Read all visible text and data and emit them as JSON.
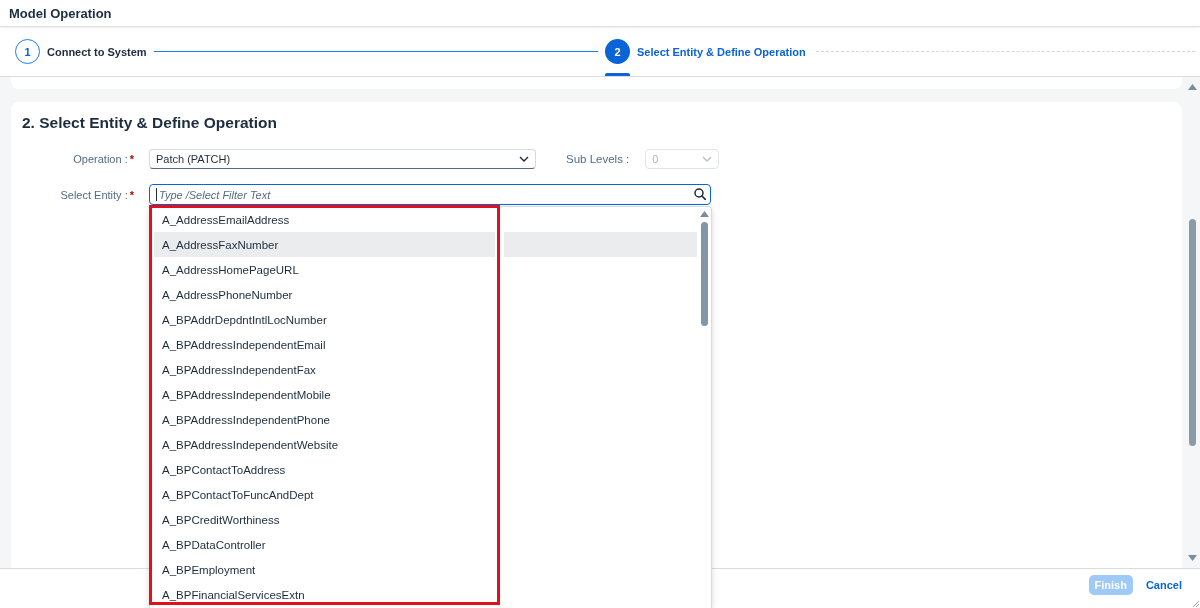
{
  "title_bar": {
    "title": "Model Operation"
  },
  "wizard": {
    "steps": [
      {
        "number": "1",
        "label": "Connect to System",
        "selected": false
      },
      {
        "number": "2",
        "label": "Select Entity & Define Operation",
        "selected": true
      }
    ]
  },
  "section": {
    "title": "2. Select Entity & Define Operation",
    "operation": {
      "label": "Operation :",
      "required_mark": "*",
      "value": "Patch (PATCH)"
    },
    "sub_levels": {
      "label": "Sub Levels :",
      "value": "0",
      "disabled": true
    },
    "entity": {
      "label": "Select Entity :",
      "required_mark": "*",
      "placeholder": "Type /Select Filter Text",
      "focused": true,
      "expanded": true,
      "options": [
        {
          "label": "A_AddressEmailAddress",
          "selected": false
        },
        {
          "label": "A_AddressFaxNumber",
          "selected": true
        },
        {
          "label": "A_AddressHomePageURL",
          "selected": false
        },
        {
          "label": "A_AddressPhoneNumber",
          "selected": false
        },
        {
          "label": "A_BPAddrDepdntIntlLocNumber",
          "selected": false
        },
        {
          "label": "A_BPAddressIndependentEmail",
          "selected": false
        },
        {
          "label": "A_BPAddressIndependentFax",
          "selected": false
        },
        {
          "label": "A_BPAddressIndependentMobile",
          "selected": false
        },
        {
          "label": "A_BPAddressIndependentPhone",
          "selected": false
        },
        {
          "label": "A_BPAddressIndependentWebsite",
          "selected": false
        },
        {
          "label": "A_BPContactToAddress",
          "selected": false
        },
        {
          "label": "A_BPContactToFuncAndDept",
          "selected": false
        },
        {
          "label": "A_BPCreditWorthiness",
          "selected": false
        },
        {
          "label": "A_BPDataController",
          "selected": false
        },
        {
          "label": "A_BPEmployment",
          "selected": false
        },
        {
          "label": "A_BPFinancialServicesExtn",
          "selected": false
        }
      ]
    }
  },
  "buttons": [
    {
      "label": "Finish",
      "kind": "primary",
      "disabled": true
    },
    {
      "label": "Cancel",
      "kind": "transparent",
      "disabled": false
    }
  ]
}
